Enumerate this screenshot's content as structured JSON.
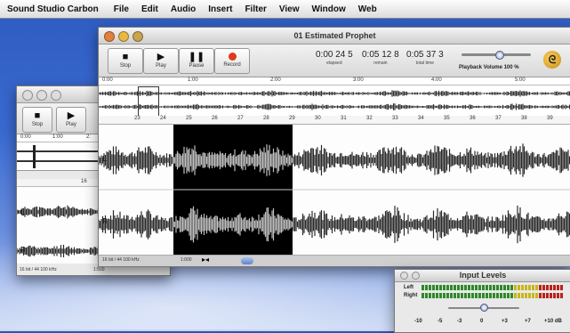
{
  "menubar": {
    "app_name": "Sound Studio Carbon",
    "items": [
      "File",
      "Edit",
      "Audio",
      "Insert",
      "Filter",
      "View",
      "Window",
      "Web"
    ]
  },
  "main_window": {
    "title": "01 Estimated Prophet",
    "buttons": {
      "stop": "Stop",
      "play": "Play",
      "pause": "Pause",
      "record": "Record"
    },
    "times": [
      {
        "value": "0:00 24 5",
        "caption": "elapsed"
      },
      {
        "value": "0:05 12 8",
        "caption": "remain"
      },
      {
        "value": "0:05 37 3",
        "caption": "total time"
      }
    ],
    "playback_volume_label": "Playback Volume  100 %",
    "overview_ticks": [
      "0:00",
      "1:00",
      "2:00",
      "3:00",
      "4:00",
      "5:00"
    ],
    "detail_ticks": [
      "23",
      "24",
      "25",
      "26",
      "27",
      "28",
      "29",
      "30",
      "31",
      "32",
      "33",
      "34",
      "35",
      "36",
      "37",
      "38",
      "39"
    ],
    "channels": [
      "L",
      "R"
    ],
    "status_text": "16 bit / 44 100 kHz",
    "zoom_text": "1:000"
  },
  "back_window": {
    "buttons": {
      "stop": "Stop",
      "play": "Play"
    },
    "ticks": [
      "0:00",
      "1:00",
      "2:"
    ],
    "sub_tick": "16",
    "channels": [
      "L",
      "R"
    ],
    "status_text": "16 bit / 44 100 kHz",
    "zoom_text": "1:500"
  },
  "input_levels": {
    "title": "Input Levels",
    "left_label": "Left",
    "right_label": "Right",
    "scale": [
      "-10",
      "-5",
      "-3",
      "0",
      "+3",
      "+7",
      "+10 dB"
    ]
  },
  "colors": {
    "record": "#e03a1a",
    "waveform": "#2a2a2a",
    "selected_waveform": "#bfbfbf",
    "selection_bg": "#000000",
    "meter_green": "#2e8a2a",
    "meter_red": "#b8231a"
  }
}
